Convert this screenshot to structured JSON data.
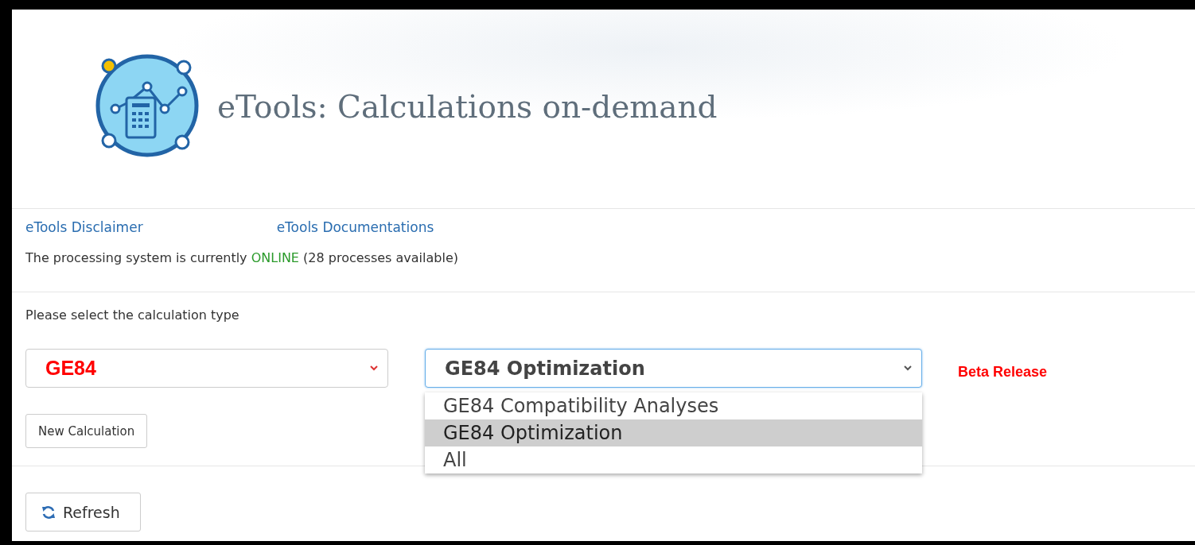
{
  "header": {
    "title": "eTools: Calculations on-demand"
  },
  "links": [
    {
      "label": "eTools Disclaimer"
    },
    {
      "label": "eTools Documentations"
    }
  ],
  "status": {
    "prefix": "The processing system is currently",
    "state": "ONLINE",
    "suffix": "(28 processes available)"
  },
  "prompt": "Please select the calculation type",
  "category_select": {
    "value": "GE84"
  },
  "type_select": {
    "value": "GE84 Optimization",
    "expanded": true,
    "options": [
      {
        "label": "GE84 Compatibility Analyses",
        "selected": false
      },
      {
        "label": "GE84 Optimization",
        "selected": true
      },
      {
        "label": "All",
        "selected": false
      }
    ]
  },
  "release_note": "Beta Release",
  "new_calculation_button": "New Calculation",
  "refresh_button": "Refresh"
}
